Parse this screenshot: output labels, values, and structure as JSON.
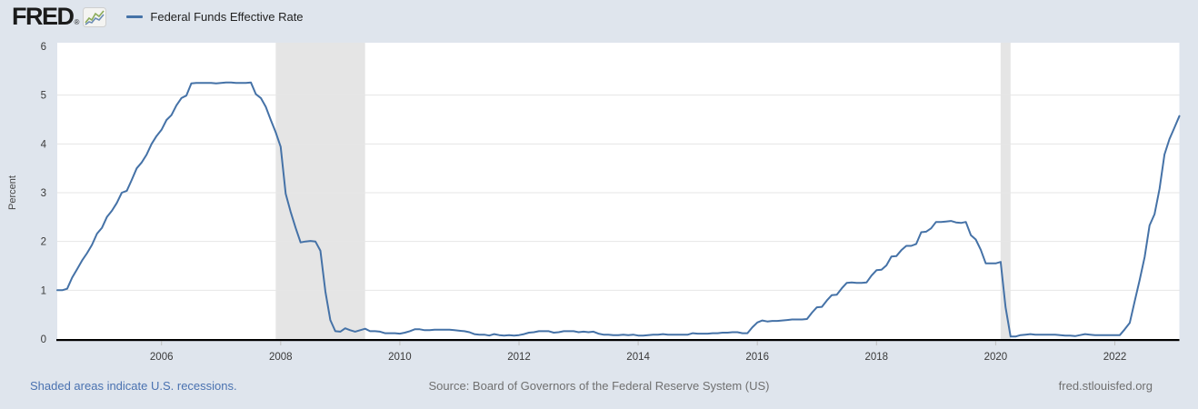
{
  "header": {
    "logo_text": "FRED",
    "logo_reg": "®"
  },
  "legend": {
    "label": "Federal Funds Effective Rate",
    "swatch_color": "#4572a7"
  },
  "footer": {
    "left": "Shaded areas indicate U.S. recessions.",
    "source": "Source: Board of Governors of the Federal Reserve System (US)",
    "site": "fred.stlouisfed.org"
  },
  "colors": {
    "background": "#dfe5ed",
    "plot_background": "#ffffff",
    "line": "#4572a7",
    "recession_band": "#e5e5e5",
    "gridline": "#e6e6e6",
    "axis_line": "#000000",
    "tick_mark": "#bfbfbf",
    "tick_text": "#3a3a3a",
    "axis_title_text": "#444444",
    "footer_link": "#4a72b0",
    "footer_text": "#707070",
    "logo_icon_green": "#8bab58",
    "logo_icon_blue": "#6b8cb5"
  },
  "chart_data": {
    "type": "line",
    "title": "Federal Funds Effective Rate",
    "xlabel": "",
    "ylabel": "Percent",
    "x_domain": [
      2004.25,
      2023.0833
    ],
    "y_domain": [
      0,
      6
    ],
    "x_ticks": [
      2006,
      2008,
      2010,
      2012,
      2014,
      2016,
      2018,
      2020,
      2022
    ],
    "y_ticks": [
      0,
      1,
      2,
      3,
      4,
      5,
      6
    ],
    "grid": true,
    "legend_position": "top-left",
    "recession_bands": [
      {
        "start": 2007.9167,
        "end": 2009.4167
      },
      {
        "start": 2020.0833,
        "end": 2020.25
      }
    ],
    "series": [
      {
        "name": "Federal Funds Effective Rate",
        "frequency": "monthly",
        "start_year": 2004,
        "start_month": 4,
        "values": [
          1.0,
          1.0,
          1.03,
          1.26,
          1.43,
          1.61,
          1.76,
          1.93,
          2.16,
          2.28,
          2.5,
          2.63,
          2.79,
          3.0,
          3.04,
          3.26,
          3.5,
          3.62,
          3.78,
          4.0,
          4.16,
          4.29,
          4.49,
          4.59,
          4.79,
          4.94,
          4.99,
          5.24,
          5.25,
          5.25,
          5.25,
          5.25,
          5.24,
          5.25,
          5.26,
          5.26,
          5.25,
          5.25,
          5.25,
          5.26,
          5.02,
          4.94,
          4.76,
          4.49,
          4.24,
          3.94,
          2.98,
          2.61,
          2.28,
          1.98,
          2.0,
          2.01,
          2.0,
          1.81,
          0.97,
          0.39,
          0.16,
          0.15,
          0.22,
          0.18,
          0.15,
          0.18,
          0.21,
          0.16,
          0.16,
          0.15,
          0.12,
          0.12,
          0.12,
          0.11,
          0.13,
          0.16,
          0.2,
          0.2,
          0.18,
          0.18,
          0.19,
          0.19,
          0.19,
          0.19,
          0.18,
          0.17,
          0.16,
          0.14,
          0.1,
          0.09,
          0.09,
          0.07,
          0.1,
          0.08,
          0.07,
          0.08,
          0.07,
          0.08,
          0.1,
          0.13,
          0.14,
          0.16,
          0.16,
          0.16,
          0.13,
          0.14,
          0.16,
          0.16,
          0.16,
          0.14,
          0.15,
          0.14,
          0.15,
          0.11,
          0.09,
          0.09,
          0.08,
          0.08,
          0.09,
          0.08,
          0.09,
          0.07,
          0.07,
          0.08,
          0.09,
          0.09,
          0.1,
          0.09,
          0.09,
          0.09,
          0.09,
          0.09,
          0.12,
          0.11,
          0.11,
          0.11,
          0.12,
          0.12,
          0.13,
          0.13,
          0.14,
          0.14,
          0.12,
          0.12,
          0.24,
          0.34,
          0.38,
          0.36,
          0.37,
          0.37,
          0.38,
          0.39,
          0.4,
          0.4,
          0.4,
          0.41,
          0.54,
          0.65,
          0.66,
          0.79,
          0.9,
          0.91,
          1.04,
          1.15,
          1.16,
          1.15,
          1.15,
          1.16,
          1.3,
          1.41,
          1.42,
          1.51,
          1.69,
          1.7,
          1.82,
          1.91,
          1.91,
          1.95,
          2.19,
          2.2,
          2.27,
          2.4,
          2.4,
          2.41,
          2.42,
          2.39,
          2.38,
          2.4,
          2.13,
          2.04,
          1.83,
          1.55,
          1.55,
          1.55,
          1.58,
          0.65,
          0.05,
          0.05,
          0.08,
          0.09,
          0.1,
          0.09,
          0.09,
          0.09,
          0.09,
          0.09,
          0.08,
          0.07,
          0.07,
          0.06,
          0.08,
          0.1,
          0.09,
          0.08,
          0.08,
          0.08,
          0.08,
          0.08,
          0.08,
          0.2,
          0.33,
          0.77,
          1.21,
          1.68,
          2.33,
          2.56,
          3.08,
          3.78,
          4.1,
          4.33,
          4.57
        ]
      }
    ]
  }
}
